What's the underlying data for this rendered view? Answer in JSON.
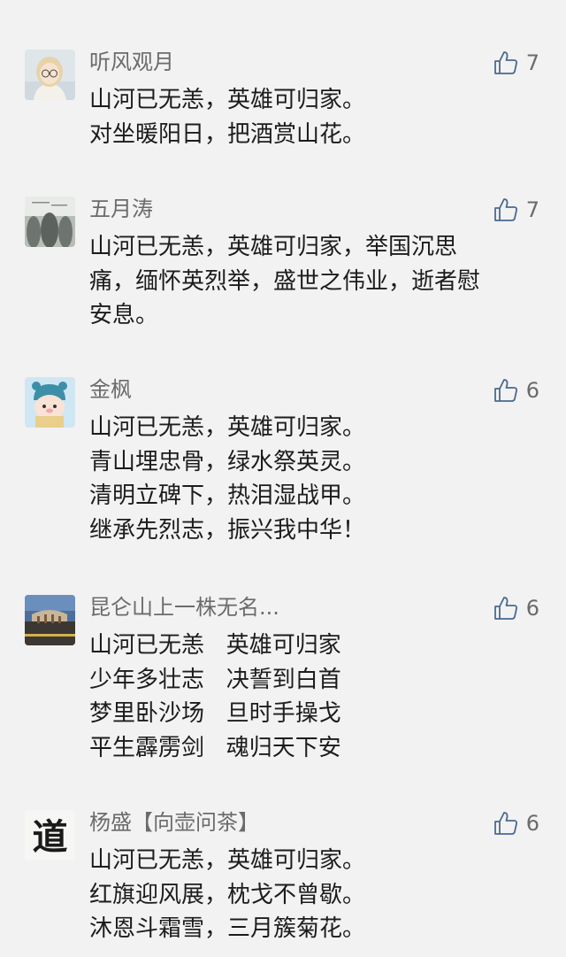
{
  "comments": [
    {
      "nickname": "听风观月",
      "likes": "7",
      "lines": [
        "山河已无恙，英雄可归家。",
        "对坐暖阳日，把酒赏山花。"
      ]
    },
    {
      "nickname": "五月涛",
      "likes": "7",
      "lines": [
        "山河已无恙，英雄可归家，举国沉思",
        "痛，缅怀英烈举，盛世之伟业，逝者慰",
        "安息。"
      ]
    },
    {
      "nickname": "金枫",
      "likes": "6",
      "lines": [
        "山河已无恙，英雄可归家。",
        "青山埋忠骨，绿水祭英灵。",
        "清明立碑下，热泪湿战甲。",
        "继承先烈志，振兴我中华！"
      ]
    },
    {
      "nickname": "昆仑山上一株无名...",
      "likes": "6",
      "lines": [
        "山河已无恙   英雄可归家",
        "少年多壮志   决誓到白首",
        "梦里卧沙场   旦时手操戈",
        "平生霹雳剑   魂归天下安"
      ]
    },
    {
      "nickname": "杨盛【向壶问茶】",
      "likes": "6",
      "lines": [
        "山河已无恙，英雄可归家。",
        "红旗迎风展，枕戈不曾歇。",
        "沐恩斗霜雪，三月簇菊花。"
      ],
      "avatar_text": "道"
    }
  ],
  "icons": {
    "like": "thumbs-up-icon"
  },
  "colors": {
    "background": "#f2f2f2",
    "nickname": "#6b6b6b",
    "text": "#1c1c1c",
    "like_icon": "#4a6a90"
  }
}
